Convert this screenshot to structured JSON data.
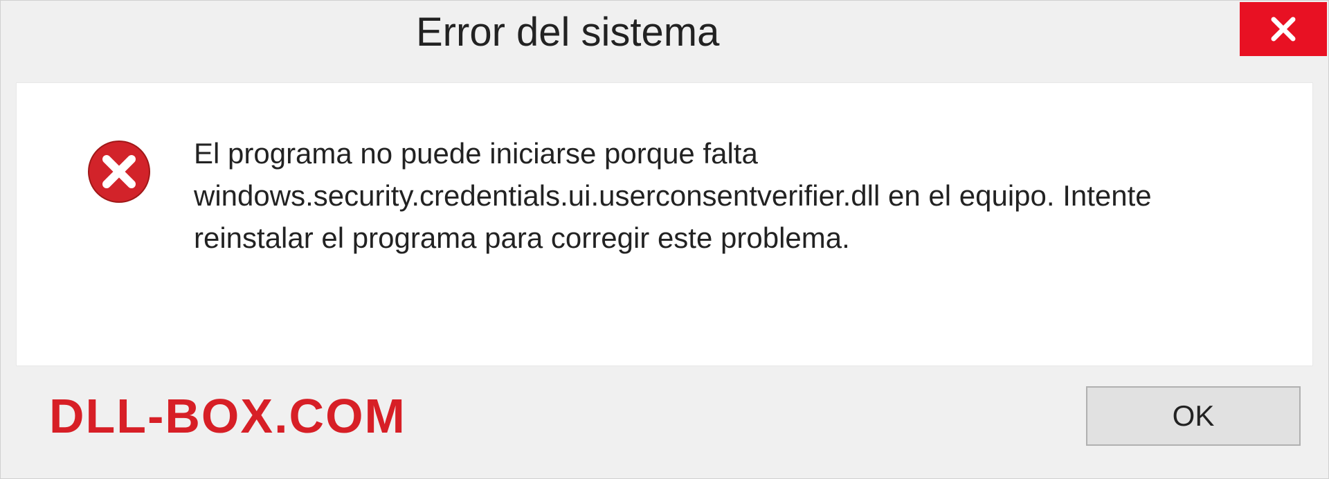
{
  "dialog": {
    "title": "Error del sistema",
    "message": "El programa no puede iniciarse porque falta windows.security.credentials.ui.userconsentverifier.dll en el equipo. Intente reinstalar el programa para corregir este problema.",
    "ok_label": "OK"
  },
  "watermark": "DLL-BOX.COM"
}
